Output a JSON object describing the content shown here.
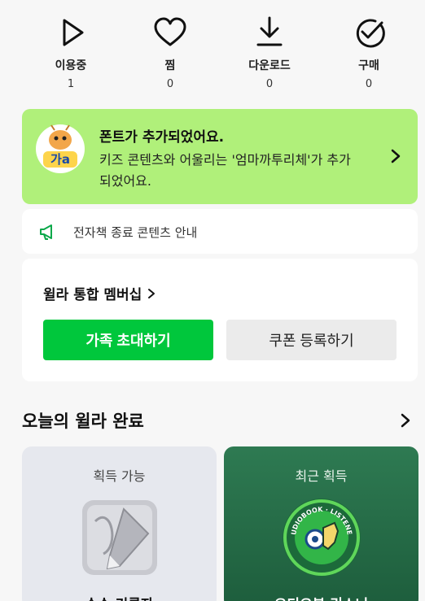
{
  "stats": [
    {
      "label": "이용중",
      "count": "1",
      "icon": "play-icon"
    },
    {
      "label": "찜",
      "count": "0",
      "icon": "heart-icon"
    },
    {
      "label": "다운로드",
      "count": "0",
      "icon": "download-icon"
    },
    {
      "label": "구매",
      "count": "0",
      "icon": "check-circle-icon"
    }
  ],
  "banner": {
    "title": "폰트가 추가되었어요.",
    "description": "키즈 콘텐츠와 어울리는 '엄마까투리체'가 추가되었어요.",
    "mascot_text": "가a",
    "color": "#b0f07a"
  },
  "notice": {
    "text": "전자책 종료 콘텐츠 안내",
    "icon": "megaphone-icon"
  },
  "membership": {
    "title": "윌라 통합 멤버십",
    "primary_button": "가족 초대하기",
    "secondary_button": "쿠폰 등록하기",
    "accent": "#00c73c"
  },
  "today": {
    "title": "오늘의 윌라 완료",
    "tiles": [
      {
        "caption": "획득 가능",
        "name": "손수 기록자",
        "icon": "pencil-badge-icon"
      },
      {
        "caption": "최근 획득",
        "name": "오디오북 리스너",
        "icon": "audiobook-listener-badge-icon",
        "badge_text": "AUDIOBOOK · LISTENER"
      }
    ]
  }
}
